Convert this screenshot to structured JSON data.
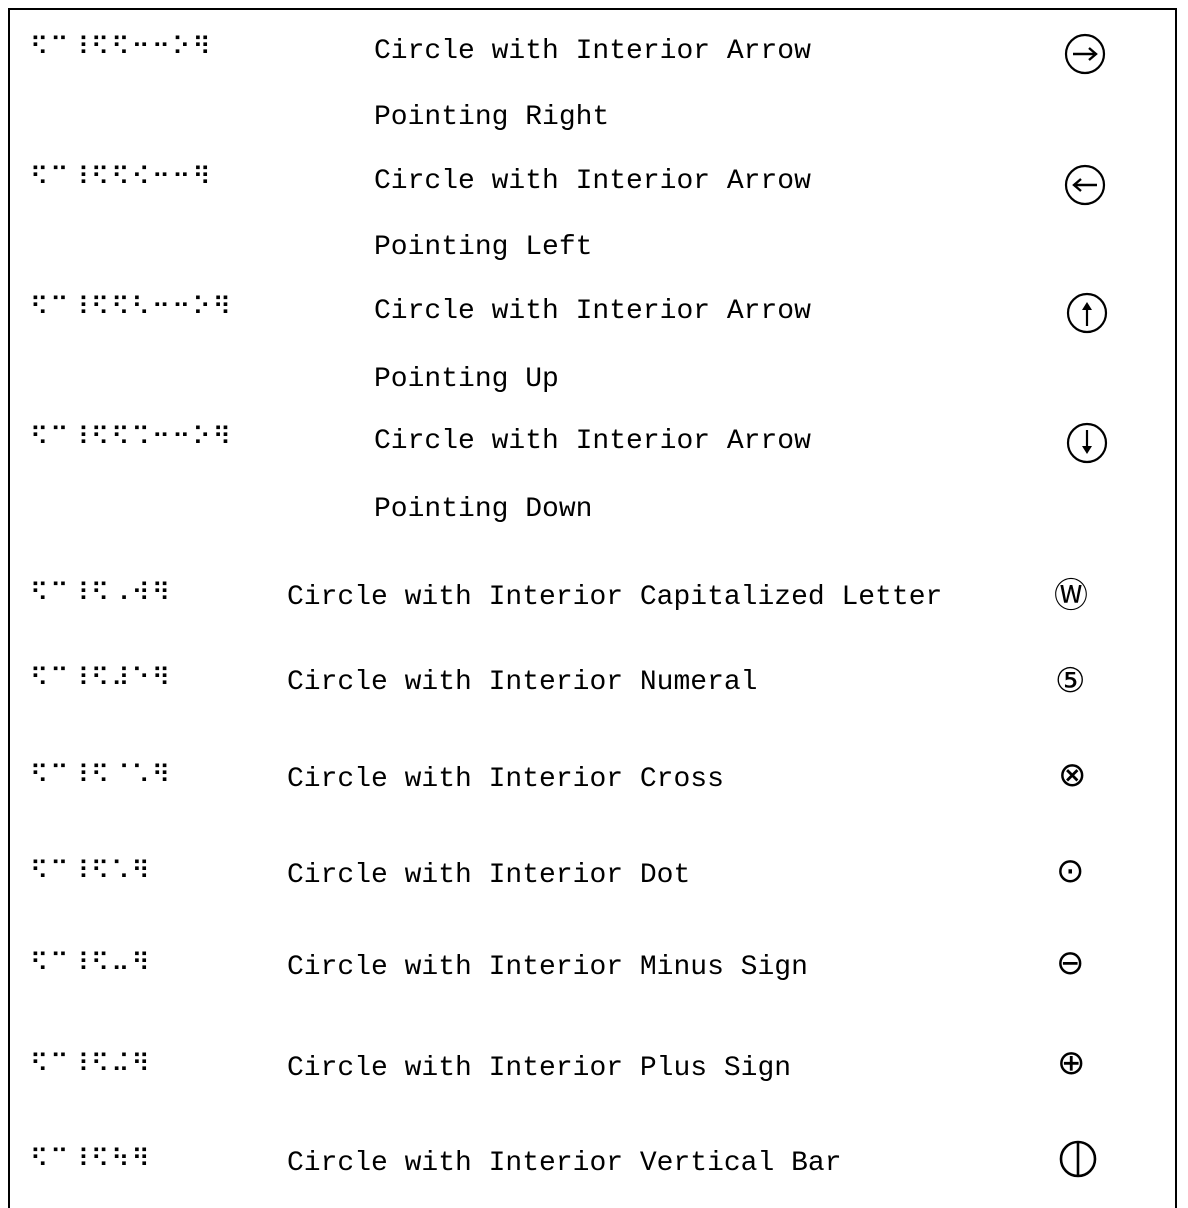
{
  "entries": [
    {
      "braille": "⠫⠉⠸⠫⠫⠒⠒⠕⠻",
      "description": [
        "Circle with Interior Arrow",
        "Pointing Right"
      ],
      "symbol_icon": "circle-arrow-right-icon"
    },
    {
      "braille": "⠫⠉⠸⠫⠫⠪⠒⠒⠻",
      "description": [
        "Circle with Interior Arrow",
        "Pointing Left"
      ],
      "symbol_icon": "circle-arrow-left-icon"
    },
    {
      "braille": "⠫⠉⠸⠫⠫⠣⠒⠒⠕⠻",
      "description": [
        "Circle with Interior Arrow",
        "Pointing Up"
      ],
      "symbol_icon": "circle-arrow-up-icon"
    },
    {
      "braille": "⠫⠉⠸⠫⠫⠩⠒⠒⠕⠻",
      "description": [
        "Circle with Interior Arrow",
        "Pointing Down"
      ],
      "symbol_icon": "circle-arrow-down-icon"
    },
    {
      "braille": "⠫⠉⠸⠫⠠⠺⠻",
      "description": [
        "Circle with Interior Capitalized Letter"
      ],
      "symbol": "Ⓦ"
    },
    {
      "braille": "⠫⠉⠸⠫⠼⠑⠻",
      "description": [
        "Circle with Interior Numeral"
      ],
      "symbol": "⑤"
    },
    {
      "braille": "⠫⠉⠸⠫⠈⠡⠻",
      "description": [
        "Circle with Interior Cross"
      ],
      "symbol": "⊗"
    },
    {
      "braille": "⠫⠉⠸⠫⠡⠻",
      "description": [
        "Circle with Interior Dot"
      ],
      "symbol": "⊙"
    },
    {
      "braille": "⠫⠉⠸⠫⠤⠻",
      "description": [
        "Circle with Interior Minus Sign"
      ],
      "symbol": "⊖"
    },
    {
      "braille": "⠫⠉⠸⠫⠬⠻",
      "description": [
        "Circle with Interior Plus Sign"
      ],
      "symbol": "⊕"
    },
    {
      "braille": "⠫⠉⠸⠫⠳⠻",
      "description": [
        "Circle with Interior Vertical Bar"
      ],
      "symbol": "⦶"
    }
  ]
}
